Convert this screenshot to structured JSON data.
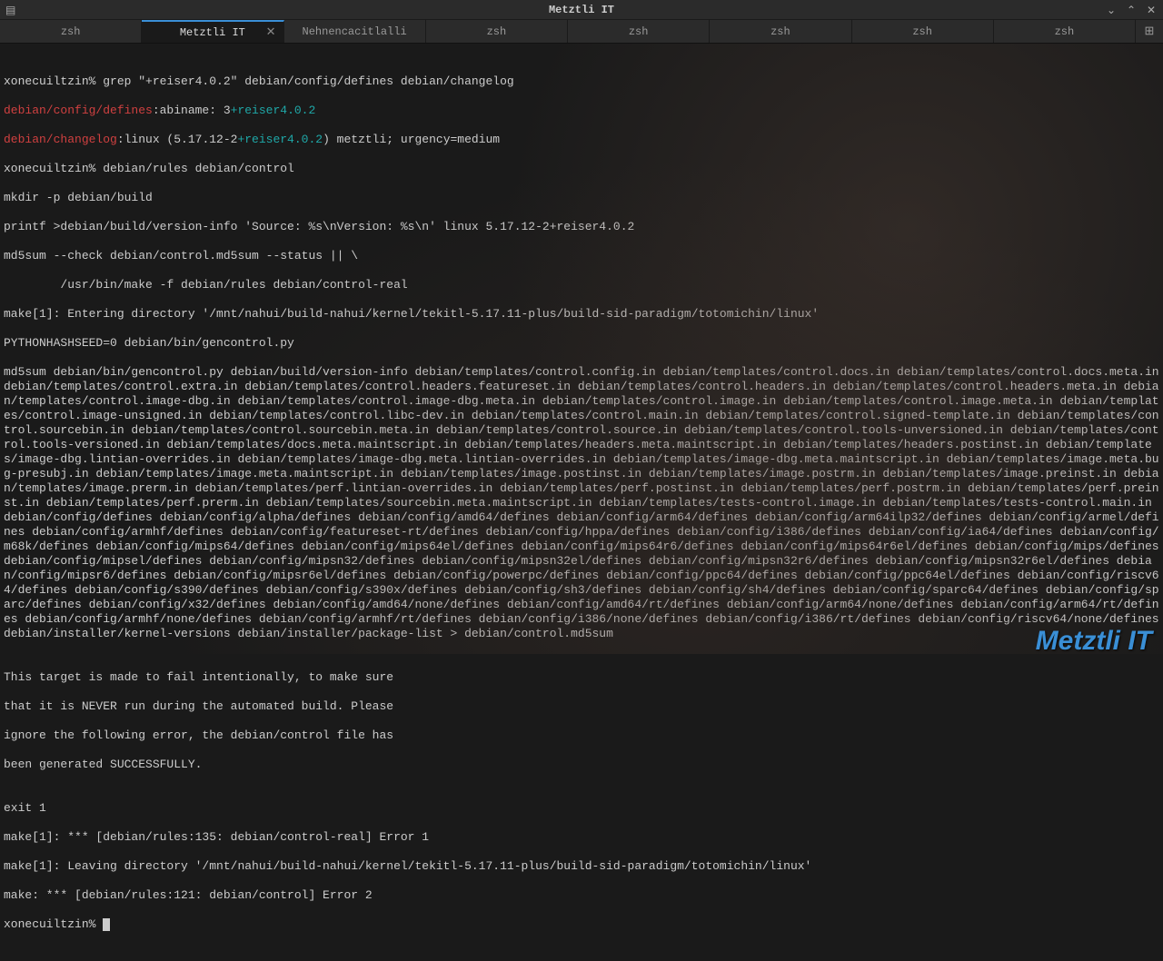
{
  "window": {
    "title": "Metztli IT",
    "watermark": "Metztli IT"
  },
  "tabs": [
    {
      "label": "zsh",
      "active": false,
      "closable": false
    },
    {
      "label": "Metztli IT",
      "active": true,
      "closable": true
    },
    {
      "label": "Nehnencacitlalli",
      "active": false,
      "closable": false
    },
    {
      "label": "zsh",
      "active": false,
      "closable": false
    },
    {
      "label": "zsh",
      "active": false,
      "closable": false
    },
    {
      "label": "zsh",
      "active": false,
      "closable": false
    },
    {
      "label": "zsh",
      "active": false,
      "closable": false
    },
    {
      "label": "zsh",
      "active": false,
      "closable": false
    }
  ],
  "terminal": {
    "l1_host": "xonecuiltzin% ",
    "l1_cmd": "grep \"+reiser4.0.2\" debian/config/defines debian/changelog",
    "l2_a": "debian/config/defines",
    "l2_b": ":abiname: 3",
    "l2_c": "+reiser4.0.2",
    "l3_a": "debian/changelog",
    "l3_b": ":linux (5.17.12-2",
    "l3_c": "+reiser4.0.2",
    "l3_d": ") metztli; urgency=medium",
    "l4_host": "xonecuiltzin% ",
    "l4_cmd": "debian/rules debian/control",
    "l5": "mkdir -p debian/build",
    "l6": "printf >debian/build/version-info 'Source: %s\\nVersion: %s\\n' linux 5.17.12-2+reiser4.0.2",
    "l7": "md5sum --check debian/control.md5sum --status || \\",
    "l8": "        /usr/bin/make -f debian/rules debian/control-real",
    "l9": "make[1]: Entering directory '/mnt/nahui/build-nahui/kernel/tekitl-5.17.11-plus/build-sid-paradigm/totomichin/linux'",
    "l10": "PYTHONHASHSEED=0 debian/bin/gencontrol.py",
    "block": "md5sum debian/bin/gencontrol.py debian/build/version-info debian/templates/control.config.in debian/templates/control.docs.in debian/templates/control.docs.meta.in debian/templates/control.extra.in debian/templates/control.headers.featureset.in debian/templates/control.headers.in debian/templates/control.headers.meta.in debian/templates/control.image-dbg.in debian/templates/control.image-dbg.meta.in debian/templates/control.image.in debian/templates/control.image.meta.in debian/templates/control.image-unsigned.in debian/templates/control.libc-dev.in debian/templates/control.main.in debian/templates/control.signed-template.in debian/templates/control.sourcebin.in debian/templates/control.sourcebin.meta.in debian/templates/control.source.in debian/templates/control.tools-unversioned.in debian/templates/control.tools-versioned.in debian/templates/docs.meta.maintscript.in debian/templates/headers.meta.maintscript.in debian/templates/headers.postinst.in debian/templates/image-dbg.lintian-overrides.in debian/templates/image-dbg.meta.lintian-overrides.in debian/templates/image-dbg.meta.maintscript.in debian/templates/image.meta.bug-presubj.in debian/templates/image.meta.maintscript.in debian/templates/image.postinst.in debian/templates/image.postrm.in debian/templates/image.preinst.in debian/templates/image.prerm.in debian/templates/perf.lintian-overrides.in debian/templates/perf.postinst.in debian/templates/perf.postrm.in debian/templates/perf.preinst.in debian/templates/perf.prerm.in debian/templates/sourcebin.meta.maintscript.in debian/templates/tests-control.image.in debian/templates/tests-control.main.in debian/config/defines debian/config/alpha/defines debian/config/amd64/defines debian/config/arm64/defines debian/config/arm64ilp32/defines debian/config/armel/defines debian/config/armhf/defines debian/config/featureset-rt/defines debian/config/hppa/defines debian/config/i386/defines debian/config/ia64/defines debian/config/m68k/defines debian/config/mips64/defines debian/config/mips64el/defines debian/config/mips64r6/defines debian/config/mips64r6el/defines debian/config/mips/defines debian/config/mipsel/defines debian/config/mipsn32/defines debian/config/mipsn32el/defines debian/config/mipsn32r6/defines debian/config/mipsn32r6el/defines debian/config/mipsr6/defines debian/config/mipsr6el/defines debian/config/powerpc/defines debian/config/ppc64/defines debian/config/ppc64el/defines debian/config/riscv64/defines debian/config/s390/defines debian/config/s390x/defines debian/config/sh3/defines debian/config/sh4/defines debian/config/sparc64/defines debian/config/sparc/defines debian/config/x32/defines debian/config/amd64/none/defines debian/config/amd64/rt/defines debian/config/arm64/none/defines debian/config/arm64/rt/defines debian/config/armhf/none/defines debian/config/armhf/rt/defines debian/config/i386/none/defines debian/config/i386/rt/defines debian/config/riscv64/none/defines debian/installer/kernel-versions debian/installer/package-list > debian/control.md5sum",
    "gap": "",
    "t1": "This target is made to fail intentionally, to make sure",
    "t2": "that it is NEVER run during the automated build. Please",
    "t3": "ignore the following error, the debian/control file has",
    "t4": "been generated SUCCESSFULLY.",
    "e1": "exit 1",
    "e2": "make[1]: *** [debian/rules:135: debian/control-real] Error 1",
    "e3": "make[1]: Leaving directory '/mnt/nahui/build-nahui/kernel/tekitl-5.17.11-plus/build-sid-paradigm/totomichin/linux'",
    "e4": "make: *** [debian/rules:121: debian/control] Error 2",
    "p_host": "xonecuiltzin% "
  }
}
